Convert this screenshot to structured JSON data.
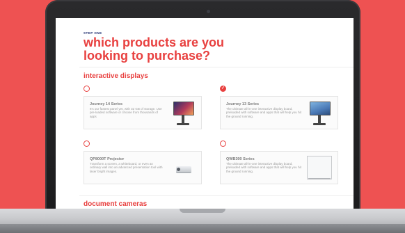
{
  "step_label": "STEP ONE",
  "heading": "which products are you looking to purchase?",
  "sections": [
    {
      "title": "interactive displays",
      "products": [
        {
          "name": "Journey 14 Series",
          "description": "It's our fastest panel yet, with 32 GB of storage. Use pre-loaded software or choose from thousands of apps",
          "selected": false,
          "icon": "interactive-display-icon"
        },
        {
          "name": "Journey 13 Series",
          "description": "The ultimate all-in-one interactive display board, preloaded with software and apps that will help you hit the ground running.",
          "selected": true,
          "icon": "interactive-display-icon"
        },
        {
          "name": "QP8000T Projector",
          "description": "Transform a screen, a whiteboard, or even an ordinary wall into an advanced presentation tool with laser bright images.",
          "selected": false,
          "icon": "projector-icon"
        },
        {
          "name": "QWB300 Series",
          "description": "The ultimate all-in-one interactive display board, preloaded with software and apps that will help you hit the ground running.",
          "selected": false,
          "icon": "whiteboard-icon"
        }
      ]
    },
    {
      "title": "document cameras"
    }
  ],
  "colors": {
    "accent": "#e8403f",
    "step": "#1a2a6c",
    "background": "#ee5252"
  }
}
